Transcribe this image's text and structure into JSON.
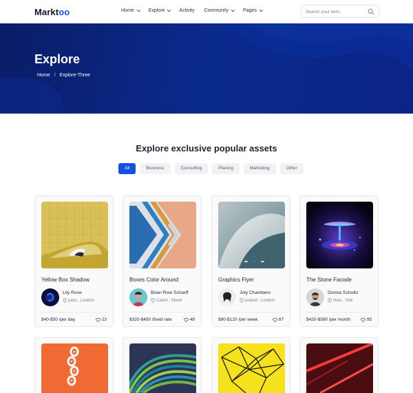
{
  "nav": {
    "logo_prefix": "Markt",
    "logo_accent": "oo",
    "items": [
      {
        "label": "Home",
        "has_caret": true
      },
      {
        "label": "Explore",
        "has_caret": true
      },
      {
        "label": "Activity",
        "has_caret": false
      },
      {
        "label": "Community",
        "has_caret": true
      },
      {
        "label": "Pages",
        "has_caret": true
      }
    ],
    "search_placeholder": "Search your item..",
    "search_icon": "magnifier-icon"
  },
  "hero": {
    "title": "Explore",
    "breadcrumb": {
      "home": "Home",
      "separator": "/",
      "current": "Explore-Three"
    }
  },
  "section": {
    "title": "Explore exclusive popular assets",
    "filters": [
      "All",
      "Biusness",
      "Consulting",
      "Planing",
      "Marketing",
      "Other"
    ],
    "active_filter": "All"
  },
  "cards": [
    {
      "title": "Yellow Box Shadow",
      "author": "Lily Rose",
      "location": "paris , London",
      "price": "$40-$50 /per day",
      "likes": "23"
    },
    {
      "title": "Boxes Color Around",
      "author": "Brian Row Scharff",
      "location": "Calvin , Street",
      "price": "$320-$450 /fixed rate",
      "likes": "48"
    },
    {
      "title": "Graphics Flyer",
      "author": "Joly Chambers",
      "location": "poland , London",
      "price": "$90-$120 /per week",
      "likes": "87"
    },
    {
      "title": "The Stone Facode",
      "author": "Donna Schultz",
      "location": "New , York",
      "price": "$420-$580 /per month",
      "likes": "95"
    }
  ],
  "colors": {
    "accent": "#1450e6",
    "hero_dark": "#0a1d66"
  }
}
